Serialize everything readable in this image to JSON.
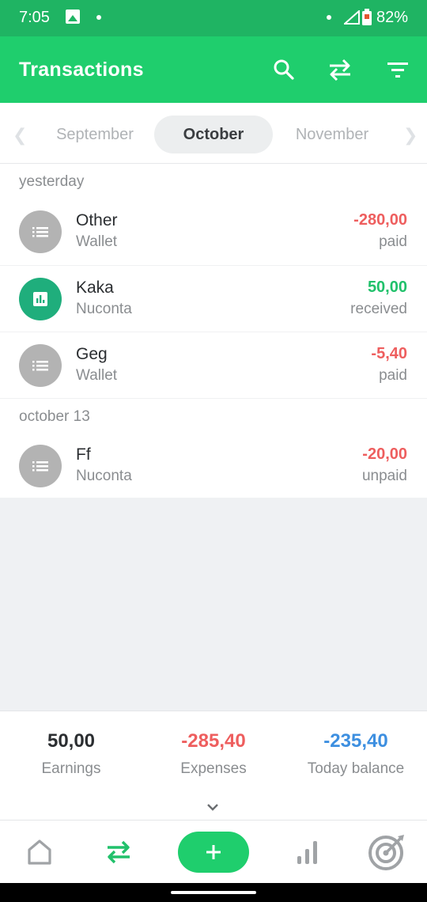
{
  "status_bar": {
    "time": "7:05",
    "battery": "82%"
  },
  "app_bar": {
    "title": "Transactions",
    "icons": [
      "search-icon",
      "swap-icon",
      "filter-icon"
    ]
  },
  "months": {
    "prev": "September",
    "current": "October",
    "next": "November"
  },
  "groups": [
    {
      "label": "yesterday",
      "items": [
        {
          "name": "Other",
          "account": "Wallet",
          "amount": "-280,00",
          "status": "paid"
        },
        {
          "name": "Kaka",
          "account": "Nuconta",
          "amount": "50,00",
          "status": "received"
        },
        {
          "name": "Geg",
          "account": "Wallet",
          "amount": "-5,40",
          "status": "paid"
        }
      ]
    },
    {
      "label": "october 13",
      "items": [
        {
          "name": "Ff",
          "account": "Nuconta",
          "amount": "-20,00",
          "status": "unpaid"
        }
      ]
    }
  ],
  "summary": {
    "earnings": {
      "value": "50,00",
      "label": "Earnings"
    },
    "expenses": {
      "value": "-285,40",
      "label": "Expenses"
    },
    "balance": {
      "value": "-235,40",
      "label": "Today balance"
    }
  },
  "colors": {
    "primary": "#1fce6d",
    "status_bar": "#1fb463",
    "negative": "#ee5e5e",
    "positive": "#21c16b",
    "balance": "#3d8fe0"
  },
  "bottom_nav": [
    "home-icon",
    "transactions-icon",
    "add-icon",
    "chart-icon",
    "goals-icon"
  ]
}
